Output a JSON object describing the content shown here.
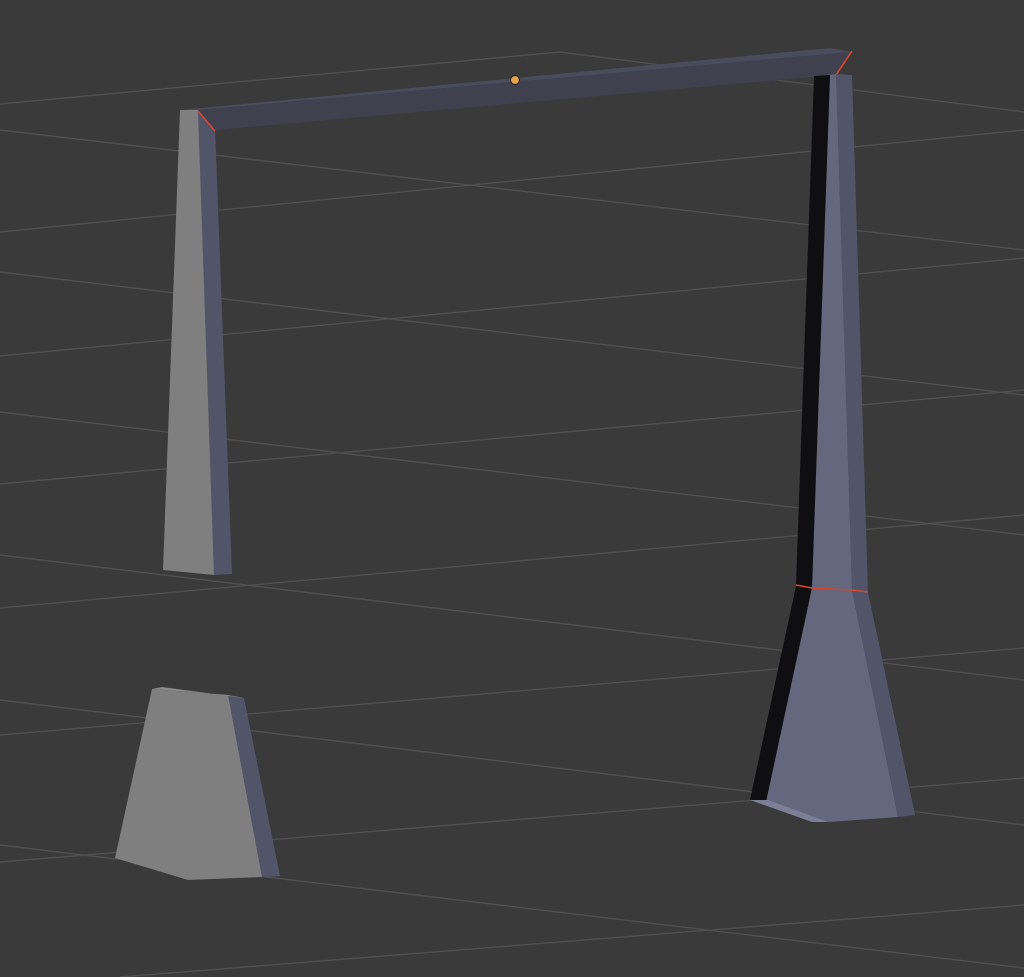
{
  "viewport": {
    "background": "#3a3a3a",
    "grid_color": "#4f4f4f"
  },
  "scene": {
    "objects": [
      "left-post",
      "top-beam",
      "right-post",
      "right-base",
      "left-base"
    ],
    "shading": {
      "unselected_face": "#7f7f7f",
      "selected_face_light": "#65677f",
      "selected_face_side": "#52546a",
      "selected_face_dark": "#40404f",
      "shadow_face": "#0f0f12",
      "seam_color": "#d8452f",
      "origin_color": "#e6a24a"
    }
  }
}
